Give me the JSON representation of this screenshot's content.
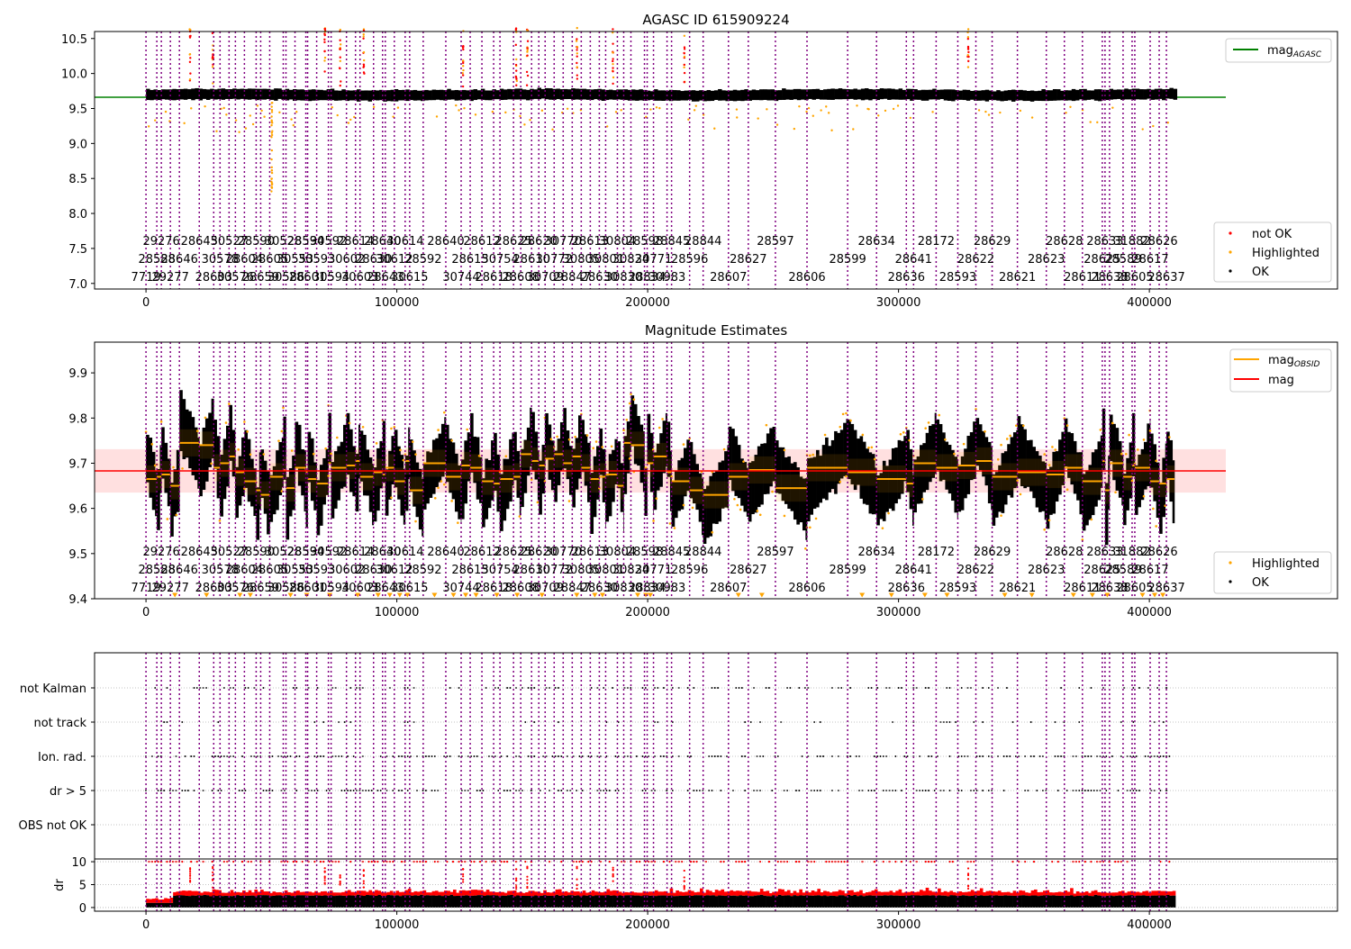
{
  "titles": {
    "top": "AGASC ID 615909224",
    "mid": "Magnitude Estimates"
  },
  "legends": {
    "top_line": {
      "label": "mag",
      "sub": "AGASC",
      "color": "#008000"
    },
    "top_points": [
      {
        "label": "not OK",
        "color": "#ff0000"
      },
      {
        "label": "Highlighted",
        "color": "#ffa500"
      },
      {
        "label": "OK",
        "color": "#000000"
      }
    ],
    "mid_lines": [
      {
        "label": "mag",
        "sub": "OBSID",
        "color": "#ffa500"
      },
      {
        "label": "mag",
        "sub": "",
        "color": "#ff0000"
      }
    ],
    "mid_points": [
      {
        "label": "Highlighted",
        "color": "#ffa500"
      },
      {
        "label": "OK",
        "color": "#000000"
      }
    ]
  },
  "colors": {
    "obsid_line": "#800080",
    "ok": "#000000",
    "highlight": "#ffa500",
    "not_ok": "#ff0000",
    "mag_band": "#ffcccc"
  },
  "chart_data": [
    {
      "type": "scatter",
      "title": "AGASC ID 615909224",
      "xlim": [
        -20500,
        475000
      ],
      "ylim": [
        6.92,
        10.6
      ],
      "xticks": [
        0,
        100000,
        200000,
        300000,
        400000
      ],
      "xtick_labels": [
        "0",
        "100000",
        "200000",
        "300000",
        "400000"
      ],
      "yticks": [
        7.0,
        7.5,
        8.0,
        8.5,
        9.0,
        9.5,
        10.0,
        10.5
      ],
      "ytick_labels": [
        "7.0",
        "7.5",
        "8.0",
        "8.5",
        "9.0",
        "9.5",
        "10.0",
        "10.5"
      ],
      "mag_agasc": 9.66,
      "ok_band": [
        9.62,
        9.77
      ],
      "not_ok_spikes": [
        17600,
        26600,
        71300,
        77400,
        86800,
        126400,
        147600,
        152000,
        171800,
        186200,
        214600,
        327800
      ]
    },
    {
      "type": "scatter",
      "title": "Magnitude Estimates",
      "xlim": [
        -20500,
        475000
      ],
      "ylim": [
        9.4,
        9.968
      ],
      "xticks": [
        0,
        100000,
        200000,
        300000,
        400000
      ],
      "xtick_labels": [
        "0",
        "100000",
        "200000",
        "300000",
        "400000"
      ],
      "yticks": [
        9.4,
        9.5,
        9.6,
        9.7,
        9.8,
        9.9
      ],
      "ytick_labels": [
        "9.4",
        "9.5",
        "9.6",
        "9.7",
        "9.8",
        "9.9"
      ],
      "mag": 9.683,
      "mag_std": 0.048,
      "mag_obsid": [
        9.665,
        9.67,
        9.675,
        9.65,
        9.745,
        9.74,
        9.69,
        9.7,
        9.715,
        9.68,
        9.66,
        9.64,
        9.63,
        9.67,
        9.685,
        9.645,
        9.69,
        9.68,
        9.665,
        9.655,
        9.7,
        9.69,
        9.695,
        9.705,
        9.67,
        9.68,
        9.675,
        9.69,
        9.66,
        9.705,
        9.64,
        9.7,
        9.67,
        9.695,
        9.69,
        9.66,
        9.655,
        9.665,
        9.67,
        9.72,
        9.705,
        9.695,
        9.71,
        9.72,
        9.7,
        9.715,
        9.69
      ]
    },
    {
      "type": "scatter",
      "categories": [
        "OBS not OK",
        "dr > 5",
        "Ion. rad.",
        "not track",
        "not Kalman"
      ],
      "dr_ylabel": "dr",
      "dr_ylim": [
        -0.8,
        10.6
      ],
      "dr_yticks": [
        0,
        5,
        10
      ],
      "dr_ytick_labels": [
        "0",
        "5",
        "10"
      ],
      "xtick_labels": [
        "0",
        "100000",
        "200000",
        "300000",
        "400000"
      ]
    }
  ],
  "obsids": [
    {
      "t": 0,
      "id": "7719",
      "row": 2
    },
    {
      "t": 4320,
      "id": "28588",
      "row": 1
    },
    {
      "t": 6120,
      "id": "29276",
      "row": 0
    },
    {
      "t": 9720,
      "id": "29277",
      "row": 2
    },
    {
      "t": 13320,
      "id": "28646",
      "row": 1
    },
    {
      "t": 21240,
      "id": "28645",
      "row": 0
    },
    {
      "t": 27000,
      "id": "28603",
      "row": 2
    },
    {
      "t": 29520,
      "id": "30578",
      "row": 1
    },
    {
      "t": 33120,
      "id": "30527",
      "row": 0
    },
    {
      "t": 35640,
      "id": "30576",
      "row": 2
    },
    {
      "t": 39240,
      "id": "28604",
      "row": 1
    },
    {
      "t": 43920,
      "id": "28590",
      "row": 0
    },
    {
      "t": 45720,
      "id": "28659",
      "row": 2
    },
    {
      "t": 49320,
      "id": "28605",
      "row": 1
    },
    {
      "t": 54720,
      "id": "30528",
      "row": 0
    },
    {
      "t": 55800,
      "id": "30586",
      "row": 2
    },
    {
      "t": 59400,
      "id": "30553",
      "row": 1
    },
    {
      "t": 63720,
      "id": "28594",
      "row": 0
    },
    {
      "t": 64440,
      "id": "28601",
      "row": 2
    },
    {
      "t": 68040,
      "id": "30593",
      "row": 1
    },
    {
      "t": 72720,
      "id": "30592",
      "row": 0
    },
    {
      "t": 73800,
      "id": "30594",
      "row": 2
    },
    {
      "t": 79920,
      "id": "30602",
      "row": 1
    },
    {
      "t": 83520,
      "id": "28614",
      "row": 0
    },
    {
      "t": 85320,
      "id": "30603",
      "row": 2
    },
    {
      "t": 90720,
      "id": "28630",
      "row": 1
    },
    {
      "t": 94320,
      "id": "28640",
      "row": 0
    },
    {
      "t": 95400,
      "id": "28643",
      "row": 2
    },
    {
      "t": 99000,
      "id": "30612",
      "row": 1
    },
    {
      "t": 103320,
      "id": "30614",
      "row": 0
    },
    {
      "t": 105120,
      "id": "30615",
      "row": 2
    },
    {
      "t": 110520,
      "id": "28592",
      "row": 1
    },
    {
      "t": 119520,
      "id": "28640",
      "row": 0
    },
    {
      "t": 125640,
      "id": "30744",
      "row": 2
    },
    {
      "t": 129240,
      "id": "28615",
      "row": 1
    },
    {
      "t": 133920,
      "id": "28612",
      "row": 0
    },
    {
      "t": 138600,
      "id": "28618",
      "row": 2
    },
    {
      "t": 141120,
      "id": "30754",
      "row": 1
    },
    {
      "t": 146520,
      "id": "28625",
      "row": 0
    },
    {
      "t": 149400,
      "id": "28608",
      "row": 2
    },
    {
      "t": 153720,
      "id": "28610",
      "row": 1
    },
    {
      "t": 156600,
      "id": "28620",
      "row": 0
    },
    {
      "t": 159120,
      "id": "30709",
      "row": 2
    },
    {
      "t": 162720,
      "id": "30772",
      "row": 1
    },
    {
      "t": 166320,
      "id": "30770",
      "row": 0
    },
    {
      "t": 169920,
      "id": "28847",
      "row": 2
    },
    {
      "t": 173520,
      "id": "30805",
      "row": 1
    },
    {
      "t": 177120,
      "id": "28613",
      "row": 0
    },
    {
      "t": 180720,
      "id": "28630",
      "row": 2
    },
    {
      "t": 183240,
      "id": "30801",
      "row": 1
    },
    {
      "t": 187920,
      "id": "30804",
      "row": 0
    },
    {
      "t": 190440,
      "id": "30830",
      "row": 2
    },
    {
      "t": 193320,
      "id": "30824",
      "row": 1
    },
    {
      "t": 198720,
      "id": "28598",
      "row": 0
    },
    {
      "t": 199800,
      "id": "28834",
      "row": 2
    },
    {
      "t": 202320,
      "id": "30771",
      "row": 1
    },
    {
      "t": 207720,
      "id": "30983",
      "row": 2
    },
    {
      "t": 209520,
      "id": "28845",
      "row": 0
    },
    {
      "t": 216720,
      "id": "28596",
      "row": 1
    },
    {
      "t": 222120,
      "id": "28844",
      "row": 0
    },
    {
      "t": 232200,
      "id": "28607",
      "row": 2
    },
    {
      "t": 240120,
      "id": "28627",
      "row": 1
    },
    {
      "t": 250920,
      "id": "28597",
      "row": 0
    },
    {
      "t": 263520,
      "id": "28606",
      "row": 2
    },
    {
      "t": 279720,
      "id": "28599",
      "row": 1
    },
    {
      "t": 291240,
      "id": "28634",
      "row": 0
    },
    {
      "t": 303120,
      "id": "28636",
      "row": 2
    },
    {
      "t": 306000,
      "id": "28641",
      "row": 1
    },
    {
      "t": 315000,
      "id": "28172",
      "row": 0
    },
    {
      "t": 323640,
      "id": "28593",
      "row": 2
    },
    {
      "t": 330840,
      "id": "28622",
      "row": 1
    },
    {
      "t": 337320,
      "id": "28629",
      "row": 0
    },
    {
      "t": 347400,
      "id": "28621",
      "row": 2
    },
    {
      "t": 358920,
      "id": "28623",
      "row": 1
    },
    {
      "t": 366120,
      "id": "28628",
      "row": 0
    },
    {
      "t": 373320,
      "id": "28611",
      "row": 2
    },
    {
      "t": 381240,
      "id": "28625",
      "row": 1
    },
    {
      "t": 382320,
      "id": "28633",
      "row": 0
    },
    {
      "t": 384120,
      "id": "28638",
      "row": 2
    },
    {
      "t": 389520,
      "id": "28589",
      "row": 1
    },
    {
      "t": 393120,
      "id": "31882",
      "row": 0
    },
    {
      "t": 394200,
      "id": "28605",
      "row": 2
    },
    {
      "t": 400320,
      "id": "28617",
      "row": 1
    },
    {
      "t": 403920,
      "id": "28626",
      "row": 0
    },
    {
      "t": 406800,
      "id": "28637",
      "row": 2
    }
  ]
}
